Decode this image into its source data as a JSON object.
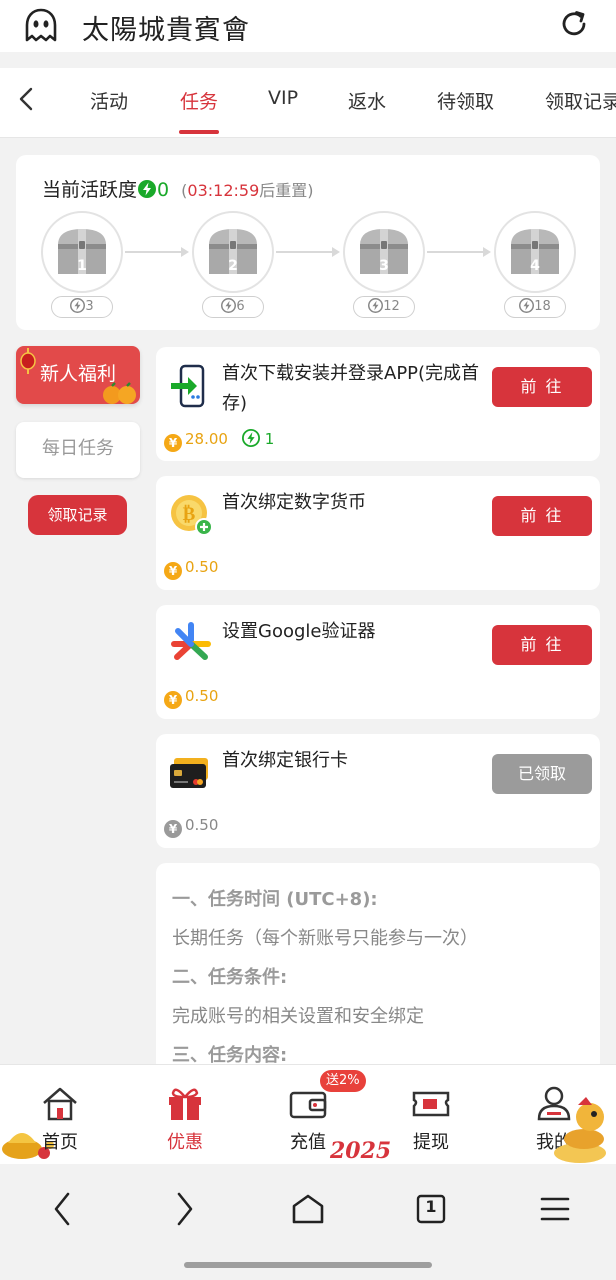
{
  "app": {
    "title": "太陽城貴賓會"
  },
  "tabs": [
    {
      "label": "活动"
    },
    {
      "label": "任务"
    },
    {
      "label": "VIP"
    },
    {
      "label": "返水"
    },
    {
      "label": "待领取"
    },
    {
      "label": "领取记录"
    }
  ],
  "activity": {
    "label": "当前活跃度",
    "value": "0",
    "timer_open": "(",
    "timer": "03:12:59",
    "timer_suffix": "后重置)",
    "chests": [
      {
        "num": "1",
        "points": "3"
      },
      {
        "num": "2",
        "points": "6"
      },
      {
        "num": "3",
        "points": "12"
      },
      {
        "num": "4",
        "points": "18"
      }
    ]
  },
  "sidebar": {
    "newbie": "新人福利",
    "daily": "每日任务",
    "claim_log": "领取记录"
  },
  "tasks": [
    {
      "name": "首次下载安装并登录APP(完成首存)",
      "action": "前 往",
      "reward": "28.00",
      "energy": "1"
    },
    {
      "name": "首次绑定数字货币",
      "action": "前 往",
      "reward": "0.50"
    },
    {
      "name": "设置Google验证器",
      "action": "前 往",
      "reward": "0.50"
    },
    {
      "name": "首次绑定银行卡",
      "action": "已领取",
      "reward": "0.50"
    }
  ],
  "rules": {
    "h1": "一、任务时间 (UTC+8):",
    "p1": "长期任务（每个新账号只能参与一次）",
    "h2": "二、任务条件:",
    "p2": "完成账号的相关设置和安全绑定",
    "h3": "三、任务内容:"
  },
  "bottom_nav": {
    "home": "首页",
    "promo": "优惠",
    "deposit": "充值",
    "withdraw": "提现",
    "mine": "我的",
    "deposit_badge": "送2%",
    "year_art": "2025"
  },
  "colors": {
    "accent": "#d7343c",
    "energy": "#1aa92a",
    "coin": "#f5a816"
  },
  "system_nav": {
    "tab_count": "1"
  }
}
